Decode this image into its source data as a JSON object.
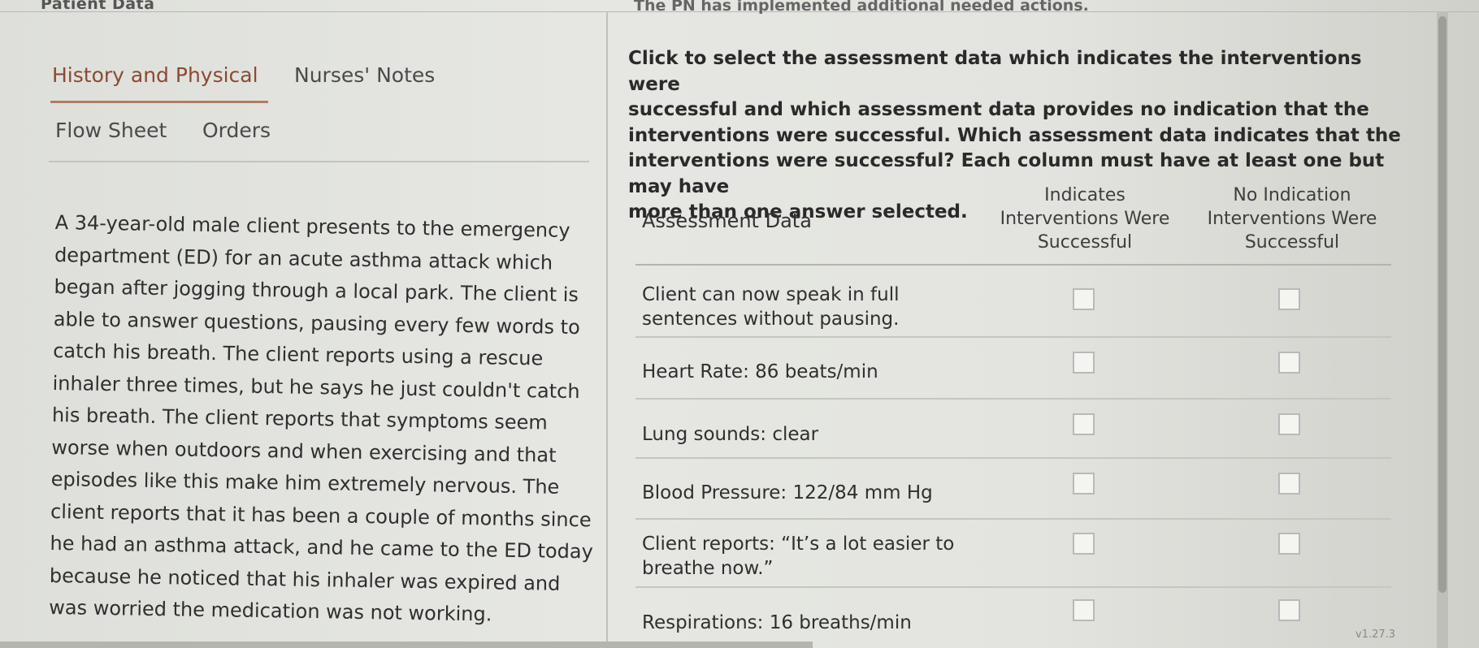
{
  "left_panel": {
    "title": "Patient Data",
    "tabs": [
      {
        "label": "History and Physical",
        "active": true
      },
      {
        "label": "Nurses' Notes",
        "active": false
      },
      {
        "label": "Flow Sheet",
        "active": false
      },
      {
        "label": "Orders",
        "active": false
      }
    ],
    "narrative": [
      "A 34-year-old male client presents to the emergency",
      "department (ED) for an acute asthma attack which",
      "began after jogging through a local park. The client is",
      "able to answer questions, pausing every few words to",
      "catch his breath. The client reports using a rescue",
      "inhaler three times, but he says he just couldn't catch",
      "his breath. The client reports that symptoms seem",
      "worse when outdoors and when exercising and that",
      "episodes like this make him extremely nervous. The",
      "client reports that it has been a couple of months since",
      "he had an asthma attack, and he came to the ED today",
      "because he noticed that his inhaler was expired and",
      "was worried the medication was not working."
    ]
  },
  "right_panel": {
    "header_cut": "The PN has implemented additional needed actions.",
    "question": [
      "Click to select the assessment data which indicates the interventions were",
      "successful and which assessment data provides no indication that the",
      "interventions were successful. Which assessment data indicates that the",
      "interventions were successful? Each column must have at least one but may have",
      "more than one answer selected."
    ],
    "columns": {
      "assessment": "Assessment Data",
      "indicates": [
        "Indicates",
        "Interventions Were",
        "Successful"
      ],
      "no_indication": [
        "No Indication",
        "Interventions Were",
        "Successful"
      ]
    },
    "rows": [
      {
        "label": [
          "Client can now speak in full",
          "sentences without pausing."
        ],
        "indicates": false,
        "no_indication": false
      },
      {
        "label": [
          "Heart Rate: 86 beats/min"
        ],
        "indicates": false,
        "no_indication": false
      },
      {
        "label": [
          "Lung sounds: clear"
        ],
        "indicates": false,
        "no_indication": false
      },
      {
        "label": [
          "Blood Pressure: 122/84 mm Hg"
        ],
        "indicates": false,
        "no_indication": false
      },
      {
        "label": [
          "Client reports: “It’s a lot easier to",
          "breathe now.”"
        ],
        "indicates": false,
        "no_indication": false
      },
      {
        "label": [
          "Respirations: 16 breaths/min"
        ],
        "indicates": false,
        "no_indication": false
      }
    ]
  },
  "footer": {
    "version": "v1.27.3"
  }
}
